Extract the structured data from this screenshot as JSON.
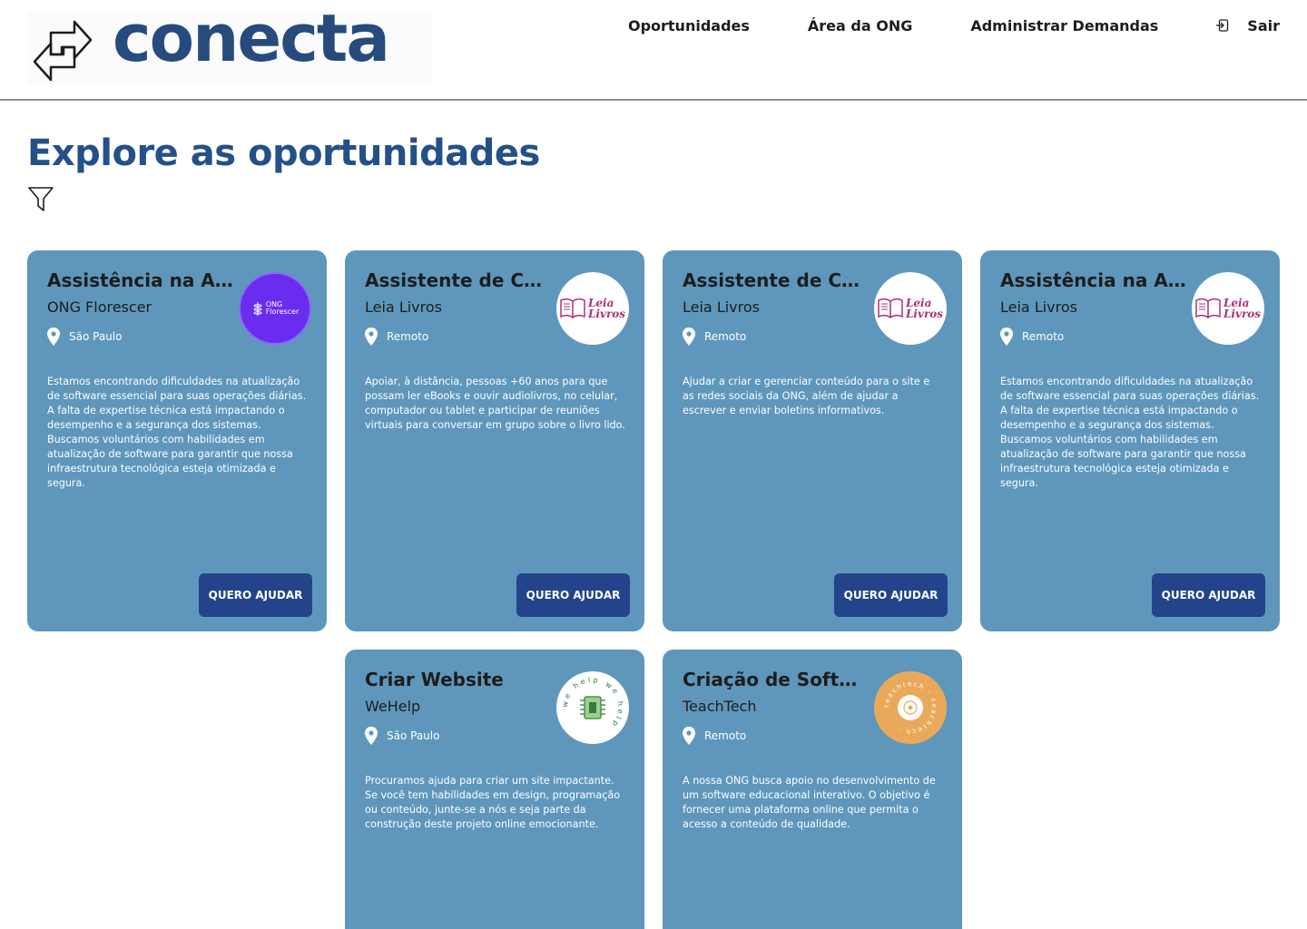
{
  "app": {
    "logo_text": "conecta",
    "brand_color": "#264b7c"
  },
  "nav": {
    "items": [
      "Oportunidades",
      "Área da ONG",
      "Administrar Demandas"
    ],
    "logout_label": "Sair",
    "logout_icon": "logout-icon"
  },
  "main": {
    "title": "Explore as oportunidades",
    "filter_icon": "filter-icon"
  },
  "cards": [
    {
      "title": "Assistência na At...",
      "org": "ONG Florescer",
      "location": "São Paulo",
      "description": "Estamos encontrando dificuldades na atualização de software essencial para suas operações diárias. A falta de expertise técnica está impactando o desempenho e a segurança dos sistemas. Buscamos voluntários com habilidades em atualização de software para garantir que nossa infraestrutura tecnológica esteja otimizada e segura.",
      "button": "QUERO AJUDAR",
      "logo": {
        "kind": "florescer",
        "line1": "ONG",
        "line2": "Florescer"
      }
    },
    {
      "title": "Assistente de Co...",
      "org": "Leia Livros",
      "location": "Remoto",
      "description": "Apoiar, à distância, pessoas +60 anos para que possam ler eBooks e ouvir audiolivros, no celular, computador ou tablet e participar de reuniões virtuais para conversar em grupo sobre o livro lido.",
      "button": "QUERO AJUDAR",
      "logo": {
        "kind": "leia",
        "line1": "Leia",
        "line2": "Livros"
      }
    },
    {
      "title": "Assistente de Co...",
      "org": "Leia Livros",
      "location": "Remoto",
      "description": "Ajudar a criar e gerenciar conteúdo para o site e as redes sociais da ONG, além de ajudar a escrever e enviar boletins informativos.",
      "button": "QUERO AJUDAR",
      "logo": {
        "kind": "leia",
        "line1": "Leia",
        "line2": "Livros"
      }
    },
    {
      "title": "Assistência na At...",
      "org": "Leia Livros",
      "location": "Remoto",
      "description": "Estamos encontrando dificuldades na atualização de software essencial para suas operações diárias. A falta de expertise técnica está impactando o desempenho e a segurança dos sistemas. Buscamos voluntários com habilidades em atualização de software para garantir que nossa infraestrutura tecnológica esteja otimizada e segura.",
      "button": "QUERO AJUDAR",
      "logo": {
        "kind": "leia",
        "line1": "Leia",
        "line2": "Livros"
      }
    },
    {
      "title": "Criar Website",
      "org": "WeHelp",
      "location": "São Paulo",
      "description": "Procuramos ajuda para criar um site impactante. Se você tem habilidades em design, programação ou conteúdo, junte-se a nós e seja parte da construção deste projeto online emocionante.",
      "button": "QUERO AJUDAR",
      "logo": {
        "kind": "wehelp",
        "ring_text": "we help we help"
      }
    },
    {
      "title": "Criação de Softw...",
      "org": "TeachTech",
      "location": "Remoto",
      "description": "A nossa ONG busca apoio no desenvolvimento de um software educacional interativo. O objetivo é fornecer uma plataforma online que permita o acesso a conteúdo de qualidade.",
      "button": "QUERO AJUDAR",
      "logo": {
        "kind": "teachtech",
        "ring_text": "teachtech · teachtech · "
      }
    }
  ]
}
